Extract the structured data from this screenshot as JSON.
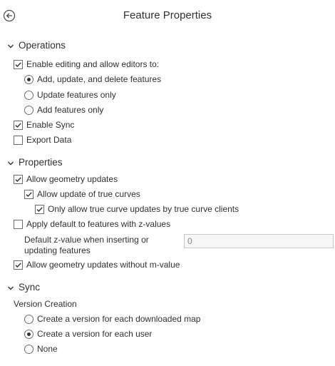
{
  "header": {
    "title": "Feature Properties"
  },
  "operations": {
    "section_label": "Operations",
    "enable_editing": {
      "label": "Enable editing and allow editors to:",
      "checked": true
    },
    "edit_modes": [
      {
        "label": "Add, update, and delete features",
        "selected": true
      },
      {
        "label": "Update features only",
        "selected": false
      },
      {
        "label": "Add features only",
        "selected": false
      }
    ],
    "enable_sync": {
      "label": "Enable Sync",
      "checked": true
    },
    "export_data": {
      "label": "Export Data",
      "checked": false
    }
  },
  "properties": {
    "section_label": "Properties",
    "allow_geometry_updates": {
      "label": "Allow geometry updates",
      "checked": true
    },
    "allow_true_curves": {
      "label": "Allow update of true curves",
      "checked": true
    },
    "true_curve_clients_only": {
      "label": "Only allow true curve updates by true curve clients",
      "checked": true
    },
    "apply_default_z": {
      "label": "Apply default to features with z-values",
      "checked": false
    },
    "default_z_label": "Default z-value when inserting or updating features",
    "default_z_value": "0",
    "allow_without_m": {
      "label": "Allow geometry updates without m-value",
      "checked": true
    }
  },
  "sync": {
    "section_label": "Sync",
    "version_creation_label": "Version Creation",
    "options": [
      {
        "label": "Create a version for each downloaded map",
        "selected": false
      },
      {
        "label": "Create a version for each user",
        "selected": true
      },
      {
        "label": "None",
        "selected": false
      }
    ]
  }
}
